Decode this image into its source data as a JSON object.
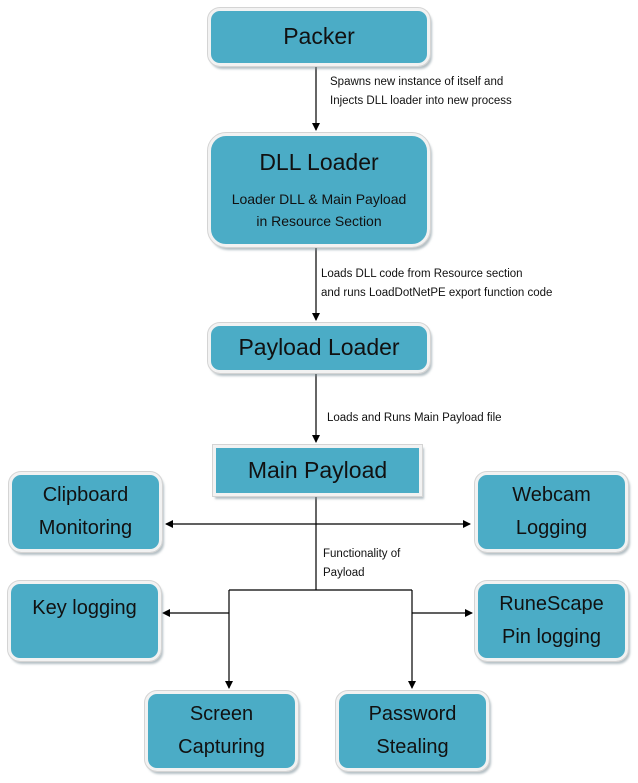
{
  "colors": {
    "node_fill": "#4bacc6",
    "node_border": "#f2f2f2",
    "line": "#000000"
  },
  "nodes": {
    "packer": {
      "title": "Packer"
    },
    "dll_loader": {
      "title": "DLL Loader",
      "sub_line1": "Loader DLL & Main Payload",
      "sub_line2": "in Resource Section"
    },
    "payload_loader": {
      "title": "Payload Loader"
    },
    "main_payload": {
      "title": "Main Payload"
    },
    "clipboard": {
      "line1": "Clipboard",
      "line2": "Monitoring"
    },
    "webcam": {
      "line1": "Webcam",
      "line2": "Logging"
    },
    "keylogging": {
      "line1": "Key logging"
    },
    "runescape": {
      "line1": "RuneScape",
      "line2": "Pin logging"
    },
    "screen": {
      "line1": "Screen",
      "line2": "Capturing"
    },
    "password": {
      "line1": "Password",
      "line2": "Stealing"
    }
  },
  "edges": {
    "packer_to_dll": {
      "line1": "Spawns new instance of itself and",
      "line2": "Injects DLL loader into new process"
    },
    "dll_to_payload_loader": {
      "line1": "Loads DLL code from Resource section",
      "line2": "and runs LoadDotNetPE export function code"
    },
    "payload_loader_to_main": {
      "line1": "Loads and Runs Main Payload file"
    },
    "main_functionality": {
      "line1": "Functionality of",
      "line2": "Payload"
    }
  }
}
